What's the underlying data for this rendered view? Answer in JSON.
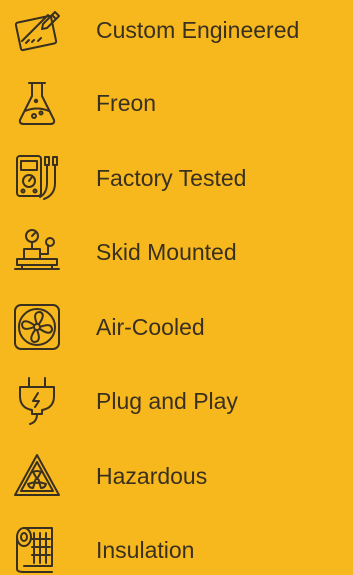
{
  "colors": {
    "background": "#F7B81E",
    "text": "#3A3020",
    "icon_stroke": "#3A3020"
  },
  "features": [
    {
      "label": "Custom Engineered",
      "icon": "ruler-pencil-icon"
    },
    {
      "label": "Freon",
      "icon": "flask-icon"
    },
    {
      "label": "Factory Tested",
      "icon": "multimeter-icon"
    },
    {
      "label": "Skid Mounted",
      "icon": "pressure-gauge-skid-icon"
    },
    {
      "label": "Air-Cooled",
      "icon": "fan-icon"
    },
    {
      "label": "Plug and Play",
      "icon": "plug-icon"
    },
    {
      "label": "Hazardous",
      "icon": "hazard-warning-icon"
    },
    {
      "label": "Insulation",
      "icon": "insulation-roll-icon"
    }
  ]
}
